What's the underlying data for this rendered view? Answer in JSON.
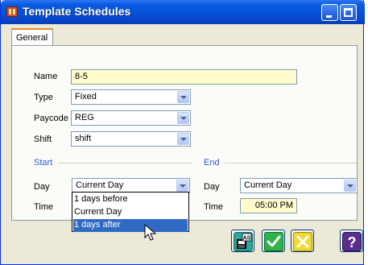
{
  "window": {
    "title": "Template Schedules",
    "icon": "calendar-app-icon"
  },
  "tabs": [
    {
      "label": "General",
      "active": true
    }
  ],
  "form": {
    "name_label": "Name",
    "name_value": "8-5",
    "type_label": "Type",
    "type_value": "Fixed",
    "paycode_label": "Paycode",
    "paycode_value": "REG",
    "shift_label": "Shift",
    "shift_value": "shift"
  },
  "start": {
    "section_title": "Start",
    "day_label": "Day",
    "day_value": "Current Day",
    "time_label": "Time",
    "dropdown_options": [
      "1 days before",
      "Current Day",
      "1 days after"
    ],
    "highlighted_option": "1 days after"
  },
  "end": {
    "section_title": "End",
    "day_label": "Day",
    "day_value": "Current Day",
    "time_label": "Time",
    "time_value": "05:00 PM"
  },
  "footer": {
    "buttons": [
      {
        "name": "save-as",
        "icon": "save-as-icon",
        "icon_text": "AS"
      },
      {
        "name": "ok",
        "icon": "checkmark-icon"
      },
      {
        "name": "cancel",
        "icon": "cancel-x-icon"
      },
      {
        "name": "help",
        "icon": "help-icon",
        "icon_text": "?"
      }
    ]
  },
  "colors": {
    "title_bar": "#0a5ce3",
    "section_title": "#2f5bd3",
    "yellow_field": "#fffbcc",
    "selection": "#316ac5",
    "ok_green": "#2eb24a",
    "cancel_yellow": "#f2d930",
    "help_purple": "#5b2d8f"
  }
}
